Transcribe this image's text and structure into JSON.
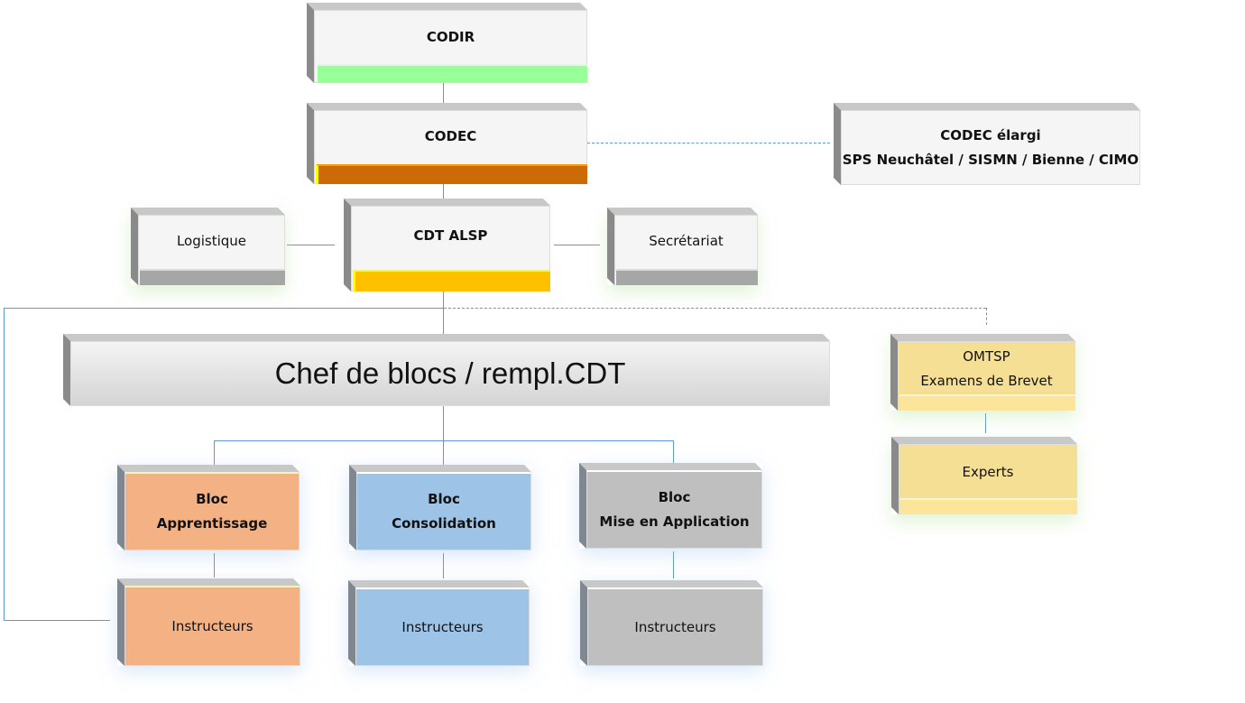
{
  "nodes": {
    "codir": {
      "label": "CODIR",
      "bar_color": "#99FF99"
    },
    "codec": {
      "label": "CODEC",
      "bar_color": "#CC6A05"
    },
    "codec_elargi": {
      "line1": "CODEC élargi",
      "line2": "SPS Neuchâtel / SISMN / Bienne / CIMO"
    },
    "cdt_alsp": {
      "label": "CDT ALSP",
      "bar_color": "#FFC000"
    },
    "logistique": {
      "label": "Logistique",
      "bar_color": "#A6A6A6"
    },
    "secretariat": {
      "label": "Secrétariat",
      "bar_color": "#A6A6A6"
    },
    "chef_blocs": {
      "label": "Chef de blocs / rempl.CDT"
    },
    "omtsp": {
      "line1": "OMTSP",
      "line2": "Examens de Brevet",
      "color": "#F5DF94"
    },
    "experts": {
      "label": "Experts",
      "color": "#F5DF94"
    },
    "bloc_apprentissage": {
      "line1": "Bloc",
      "line2": "Apprentissage",
      "color": "#F4B183"
    },
    "bloc_consolidation": {
      "line1": "Bloc",
      "line2": "Consolidation",
      "color": "#9DC3E6"
    },
    "bloc_mise": {
      "line1": "Bloc",
      "line2": "Mise en Application",
      "color": "#BFBFBF"
    },
    "instr_apprentissage": {
      "label": "Instructeurs"
    },
    "instr_consolidation": {
      "label": "Instructeurs"
    },
    "instr_mise": {
      "label": "Instructeurs"
    }
  },
  "line_color": "#5B9BD5"
}
